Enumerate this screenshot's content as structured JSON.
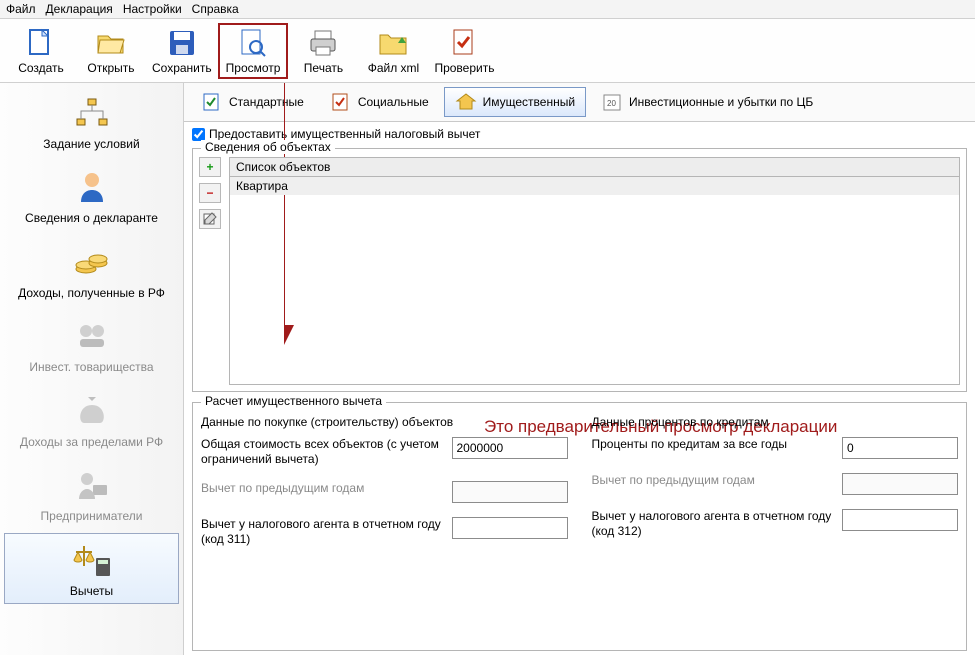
{
  "menu": {
    "file": "Файл",
    "declaration": "Декларация",
    "settings": "Настройки",
    "help": "Справка"
  },
  "toolbar": {
    "create": "Создать",
    "open": "Открыть",
    "save": "Сохранить",
    "preview": "Просмотр",
    "print": "Печать",
    "filexml": "Файл xml",
    "check": "Проверить"
  },
  "sidebar": {
    "conditions": "Задание условий",
    "declarant": "Сведения о декларанте",
    "income_rf": "Доходы, полученные в РФ",
    "invest": "Инвест. товарищества",
    "income_abroad": "Доходы за пределами РФ",
    "entrepreneurs": "Предприниматели",
    "deductions": "Вычеты"
  },
  "dtabs": {
    "standard": "Стандартные",
    "social": "Социальные",
    "property": "Имущественный",
    "invest_cb": "Инвестиционные и убытки по ЦБ"
  },
  "checkbox_provide": "Предоставить имущественный налоговый вычет",
  "objects": {
    "legend": "Сведения об объектах",
    "header": "Список объектов",
    "row1": "Квартира"
  },
  "annotation": "Это предварительный просмотр декларации",
  "calc": {
    "legend": "Расчет имущественного вычета",
    "col1_title": "Данные по покупке (строительству) объектов",
    "col2_title": "Данные процентов по кредитам",
    "total_cost_label": "Общая стоимость всех объектов (с учетом ограничений вычета)",
    "total_cost_value": "2000000",
    "interest_label": "Проценты по кредитам за все годы",
    "interest_value": "0",
    "prev_years": "Вычет по предыдущим годам",
    "agent_311": "Вычет у налогового агента в отчетном году (код 311)",
    "agent_312": "Вычет у налогового агента в отчетном году (код 312)"
  }
}
